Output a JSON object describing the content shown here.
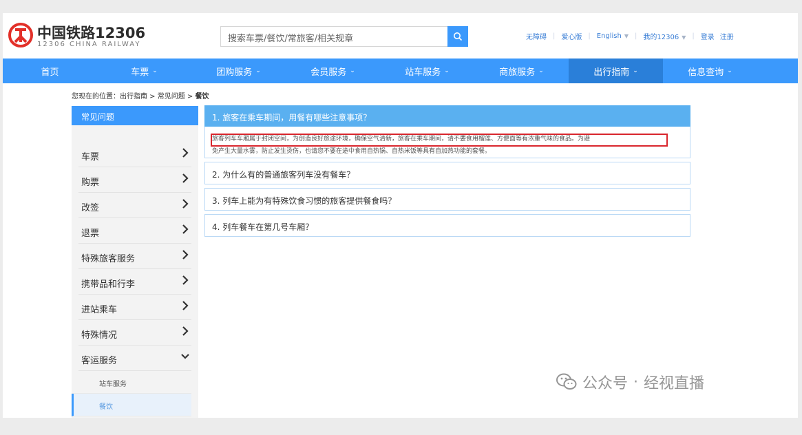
{
  "brand": {
    "name_cn": "中国铁路12306",
    "name_en": "12306 CHINA RAILWAY",
    "logo_icon": "railway-logo-icon",
    "color": "#e23029"
  },
  "search": {
    "placeholder": "搜索车票/餐饮/常旅客/相关规章",
    "icon": "search-icon"
  },
  "top_links": {
    "accessible": "无障碍",
    "care": "爱心版",
    "language": "English",
    "my_account": "我的12306",
    "login": "登录",
    "register": "注册"
  },
  "nav": {
    "items": [
      {
        "label": "首页",
        "has_menu": false
      },
      {
        "label": "车票",
        "has_menu": true
      },
      {
        "label": "团购服务",
        "has_menu": true
      },
      {
        "label": "会员服务",
        "has_menu": true
      },
      {
        "label": "站车服务",
        "has_menu": true
      },
      {
        "label": "商旅服务",
        "has_menu": true
      },
      {
        "label": "出行指南",
        "has_menu": true,
        "active": true
      },
      {
        "label": "信息查询",
        "has_menu": true
      }
    ],
    "accent": "#3b99fc",
    "active_bg": "#2a7fd9"
  },
  "breadcrumb": {
    "prefix": "您现在的位置：出行指南 > 常见问题 > ",
    "current": "餐饮"
  },
  "sidebar": {
    "title": "常见问题",
    "items": [
      {
        "label": "车票"
      },
      {
        "label": "购票"
      },
      {
        "label": "改签"
      },
      {
        "label": "退票"
      },
      {
        "label": "特殊旅客服务"
      },
      {
        "label": "携带品和行李"
      },
      {
        "label": "进站乘车"
      },
      {
        "label": "特殊情况"
      },
      {
        "label": "客运服务",
        "expanded": true
      }
    ],
    "sub_items": [
      {
        "label": "站车服务"
      },
      {
        "label": "餐饮",
        "active": true
      }
    ]
  },
  "faq": {
    "questions": [
      "1. 旅客在乘车期间，用餐有哪些注意事项？",
      "2. 为什么有的普通旅客列车没有餐车？",
      "3. 列车上能为有特殊饮食习惯的旅客提供餐食吗？",
      "4. 列车餐车在第几号车厢？"
    ],
    "answer_line1": "旅客列车车厢属于封闭空间，为创造良好旅途环境，确保空气清新，旅客在乘车期间，请不要食用榴莲、方便面等有浓重气味的食品。为避",
    "answer_line2": "免产生大量水雾，防止发生烫伤，也请您不要在途中食用自热锅、自热米饭等具有自加热功能的套餐。",
    "highlight_color": "#d9262d"
  },
  "watermark": {
    "platform": "公众号",
    "separator": "·",
    "account": "经视直播"
  }
}
